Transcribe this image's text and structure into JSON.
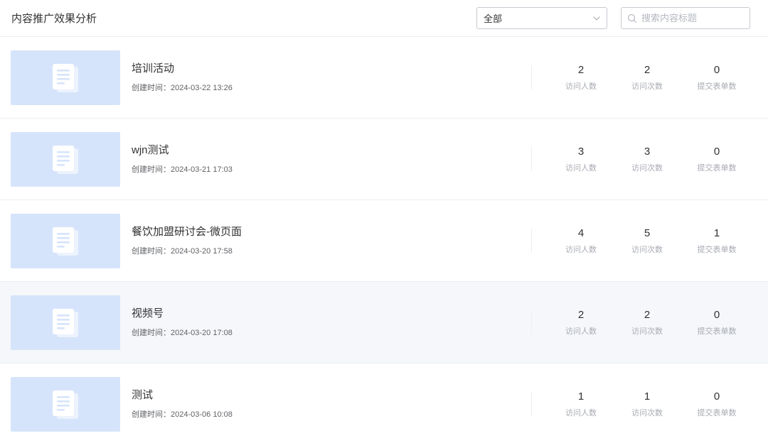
{
  "header": {
    "title": "内容推广效果分析",
    "filter": {
      "selected": "全部"
    },
    "search": {
      "placeholder": "搜索内容标题",
      "value": ""
    }
  },
  "stat_labels": {
    "visitors": "访问人数",
    "visits": "访问次数",
    "submissions": "提交表单数"
  },
  "meta_prefix": "创建时间：",
  "items": [
    {
      "title": "培训活动",
      "created": "2024-03-22 13:26",
      "visitors": "2",
      "visits": "2",
      "submissions": "0"
    },
    {
      "title": "wjn测试",
      "created": "2024-03-21 17:03",
      "visitors": "3",
      "visits": "3",
      "submissions": "0"
    },
    {
      "title": "餐饮加盟研讨会-微页面",
      "created": "2024-03-20 17:58",
      "visitors": "4",
      "visits": "5",
      "submissions": "1"
    },
    {
      "title": "视频号",
      "created": "2024-03-20 17:08",
      "visitors": "2",
      "visits": "2",
      "submissions": "0"
    },
    {
      "title": "测试",
      "created": "2024-03-06 10:08",
      "visitors": "1",
      "visits": "1",
      "submissions": "0"
    }
  ],
  "icons": {
    "thumb": "document-icon",
    "search": "search-icon",
    "dropdown": "chevron-down-icon"
  },
  "colors": {
    "thumb_bg": "#d6e4fb",
    "row_hover_bg": "#f5f7fa"
  }
}
